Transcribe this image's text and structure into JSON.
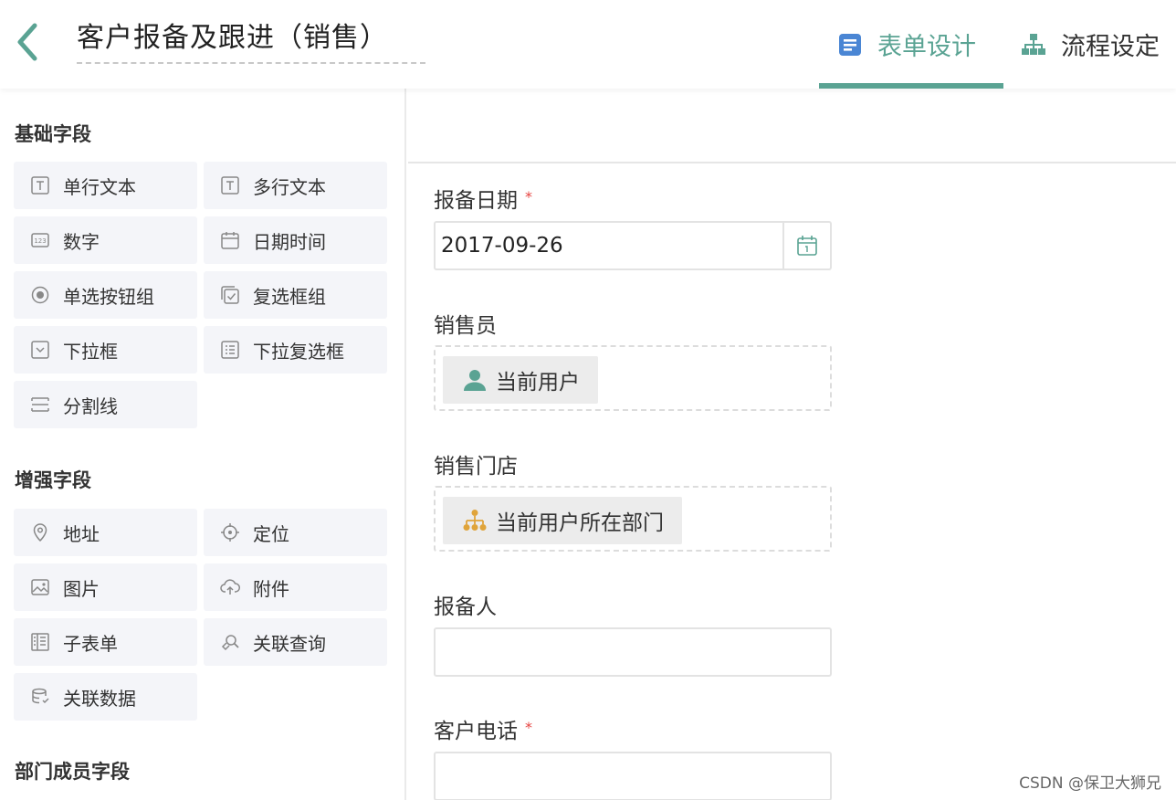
{
  "header": {
    "title": "客户报备及跟进（销售）",
    "tabs": [
      {
        "label": "表单设计",
        "icon": "form-icon",
        "active": true
      },
      {
        "label": "流程设定",
        "icon": "flow-icon",
        "active": false
      }
    ]
  },
  "sidebar": {
    "basic": {
      "title": "基础字段",
      "items": [
        {
          "label": "单行文本",
          "icon": "text-box-icon"
        },
        {
          "label": "多行文本",
          "icon": "text-box-icon"
        },
        {
          "label": "数字",
          "icon": "number-icon"
        },
        {
          "label": "日期时间",
          "icon": "calendar-icon"
        },
        {
          "label": "单选按钮组",
          "icon": "radio-icon"
        },
        {
          "label": "复选框组",
          "icon": "checkbox-icon"
        },
        {
          "label": "下拉框",
          "icon": "dropdown-icon"
        },
        {
          "label": "下拉复选框",
          "icon": "checklist-icon"
        },
        {
          "label": "分割线",
          "icon": "divider-icon"
        }
      ]
    },
    "enhanced": {
      "title": "增强字段",
      "items": [
        {
          "label": "地址",
          "icon": "location-pin-icon"
        },
        {
          "label": "定位",
          "icon": "crosshair-icon"
        },
        {
          "label": "图片",
          "icon": "image-icon"
        },
        {
          "label": "附件",
          "icon": "upload-cloud-icon"
        },
        {
          "label": "子表单",
          "icon": "subform-icon"
        },
        {
          "label": "关联查询",
          "icon": "link-search-icon"
        },
        {
          "label": "关联数据",
          "icon": "database-icon"
        }
      ]
    },
    "department": {
      "title": "部门成员字段"
    }
  },
  "form": {
    "fields": [
      {
        "label": "报备日期",
        "required": true,
        "value": "2017-09-26"
      },
      {
        "label": "销售员",
        "required": false,
        "chip": "当前用户"
      },
      {
        "label": "销售门店",
        "required": false,
        "chip": "当前用户所在部门"
      },
      {
        "label": "报备人",
        "required": false,
        "value": ""
      },
      {
        "label": "客户电话",
        "required": true,
        "value": ""
      }
    ],
    "required_mark": "*"
  },
  "watermark": "CSDN @保卫大狮兄",
  "colors": {
    "accent": "#5aa393",
    "tab_icon_blue": "#4a86d4",
    "dept_orange": "#e0a43a",
    "required": "#e64340"
  }
}
